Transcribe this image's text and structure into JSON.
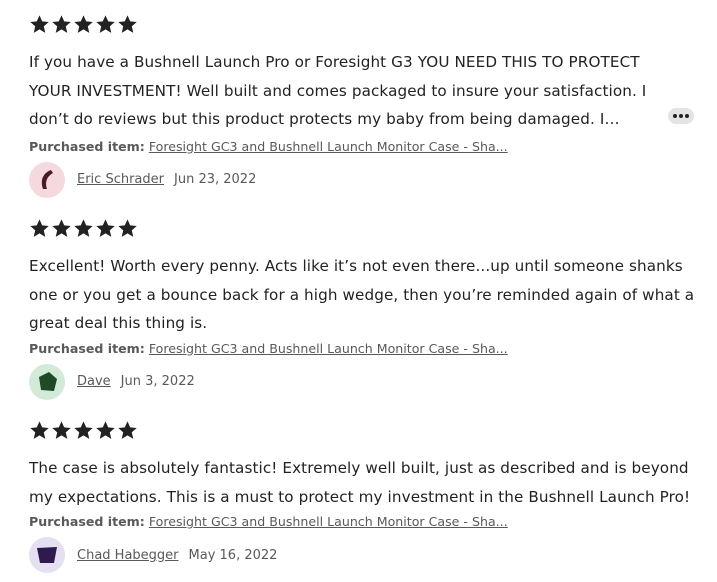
{
  "reviews": [
    {
      "rating": 5,
      "text": "If you have a Bushnell Launch Pro or Foresight G3 YOU NEED THIS TO PROTECT YOUR INVESTMENT! Well built and comes packaged to insure your satisfaction. I don’t do reviews but this product protects my baby from being damaged. I was...",
      "purchased_label": "Purchased item:",
      "purchased_item": "Foresight GC3 and Bushnell Launch Monitor Case - Sha...",
      "reviewer": "Eric Schrader",
      "date": "Jun 23, 2022",
      "avatar_icon": "pink-crescent-avatar-icon",
      "avatar_bg": "#f4d9df",
      "avatar_fg": "#4a1a2a",
      "more_icon": "ellipsis-icon"
    },
    {
      "rating": 5,
      "text": "Excellent! Worth every penny. Acts like it’s not even there...up until someone shanks one or you get a bounce back for a high wedge, then you’re reminded again of what a great deal this thing is.",
      "purchased_label": "Purchased item:",
      "purchased_item": "Foresight GC3 and Bushnell Launch Monitor Case - Sha...",
      "reviewer": "Dave",
      "date": "Jun 3, 2022",
      "avatar_icon": "green-pentagon-avatar-icon",
      "avatar_bg": "#d2ead7",
      "avatar_fg": "#1e4a25"
    },
    {
      "rating": 5,
      "text": "The case is absolutely fantastic! Extremely well built, just as described and is beyond my expectations. This is a must to protect my investment in the Bushnell Launch Pro!",
      "purchased_label": "Purchased item:",
      "purchased_item": "Foresight GC3 and Bushnell Launch Monitor Case - Sha...",
      "reviewer": "Chad Habegger",
      "date": "May 16, 2022",
      "avatar_icon": "purple-cup-avatar-icon",
      "avatar_bg": "#e4e0f2",
      "avatar_fg": "#2e1a4f"
    }
  ],
  "star_color": "#222222"
}
